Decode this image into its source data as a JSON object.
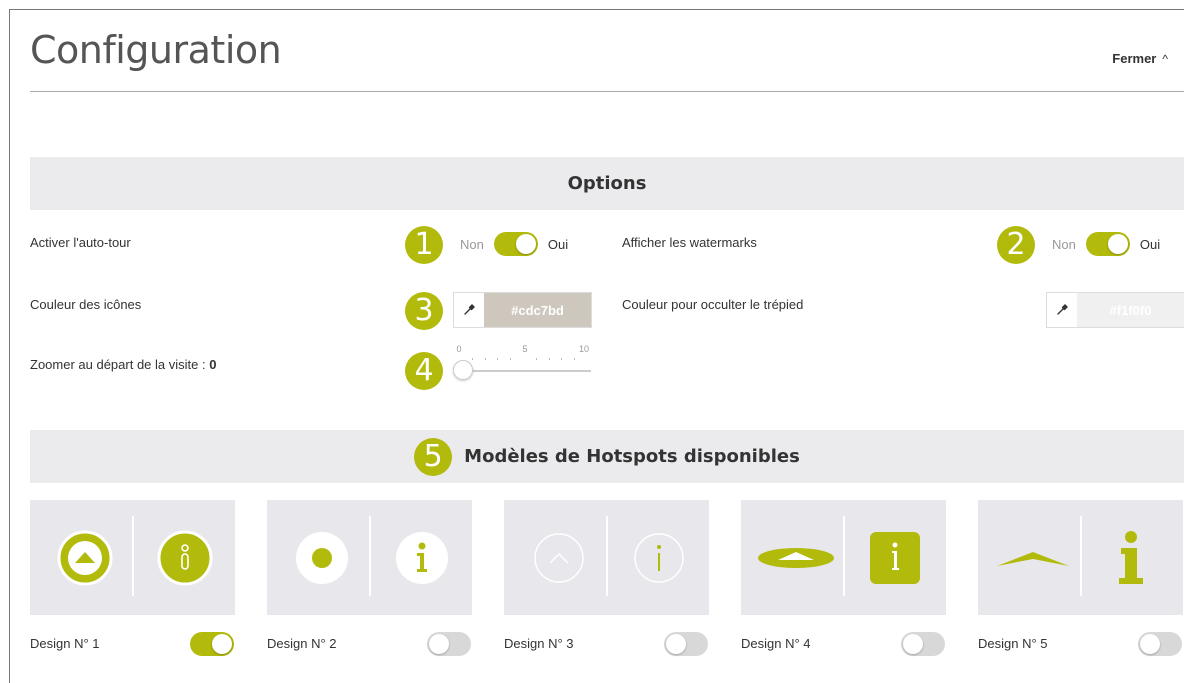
{
  "header": {
    "title": "Configuration",
    "close_label": "Fermer",
    "close_chevron": "^"
  },
  "options": {
    "section_title": "Options",
    "autotour": {
      "label": "Activer l'auto-tour",
      "badge": "1",
      "off_label": "Non",
      "on_label": "Oui",
      "checked": true
    },
    "watermarks": {
      "label": "Afficher les watermarks",
      "badge": "2",
      "off_label": "Non",
      "on_label": "Oui",
      "checked": true
    },
    "icon_color": {
      "label": "Couleur des icônes",
      "badge": "3",
      "value": "#cdc7bd",
      "icon": "eyedropper-icon"
    },
    "tripod_color": {
      "label": "Couleur pour occulter le trépied",
      "value": "#f1f0f0",
      "icon": "eyedropper-icon"
    },
    "zoom": {
      "label": "Zoomer au départ de la visite : ",
      "value": "0",
      "badge": "4",
      "min": 0,
      "max": 10,
      "tick_labels": [
        "0",
        "5",
        "10"
      ]
    }
  },
  "models": {
    "section_title": "Modèles de Hotspots disponibles",
    "badge": "5",
    "designs": [
      {
        "label": "Design N° 1",
        "enabled": true,
        "icons": [
          "chevron-up-circle-icon",
          "info-circle-icon"
        ]
      },
      {
        "label": "Design N° 2",
        "enabled": false,
        "icons": [
          "dot-circle-icon",
          "info-circle-icon"
        ]
      },
      {
        "label": "Design N° 3",
        "enabled": false,
        "icons": [
          "chevron-up-outline-icon",
          "info-outline-icon"
        ]
      },
      {
        "label": "Design N° 4",
        "enabled": false,
        "icons": [
          "ellipse-arrow-icon",
          "info-square-icon"
        ]
      },
      {
        "label": "Design N° 5",
        "enabled": false,
        "icons": [
          "chevron-wide-icon",
          "info-serif-icon"
        ]
      }
    ]
  },
  "colors": {
    "accent": "#b2ba0b",
    "band": "#ebebee",
    "card": "#e8e8ec",
    "toggle_off": "#d8d8d8"
  }
}
